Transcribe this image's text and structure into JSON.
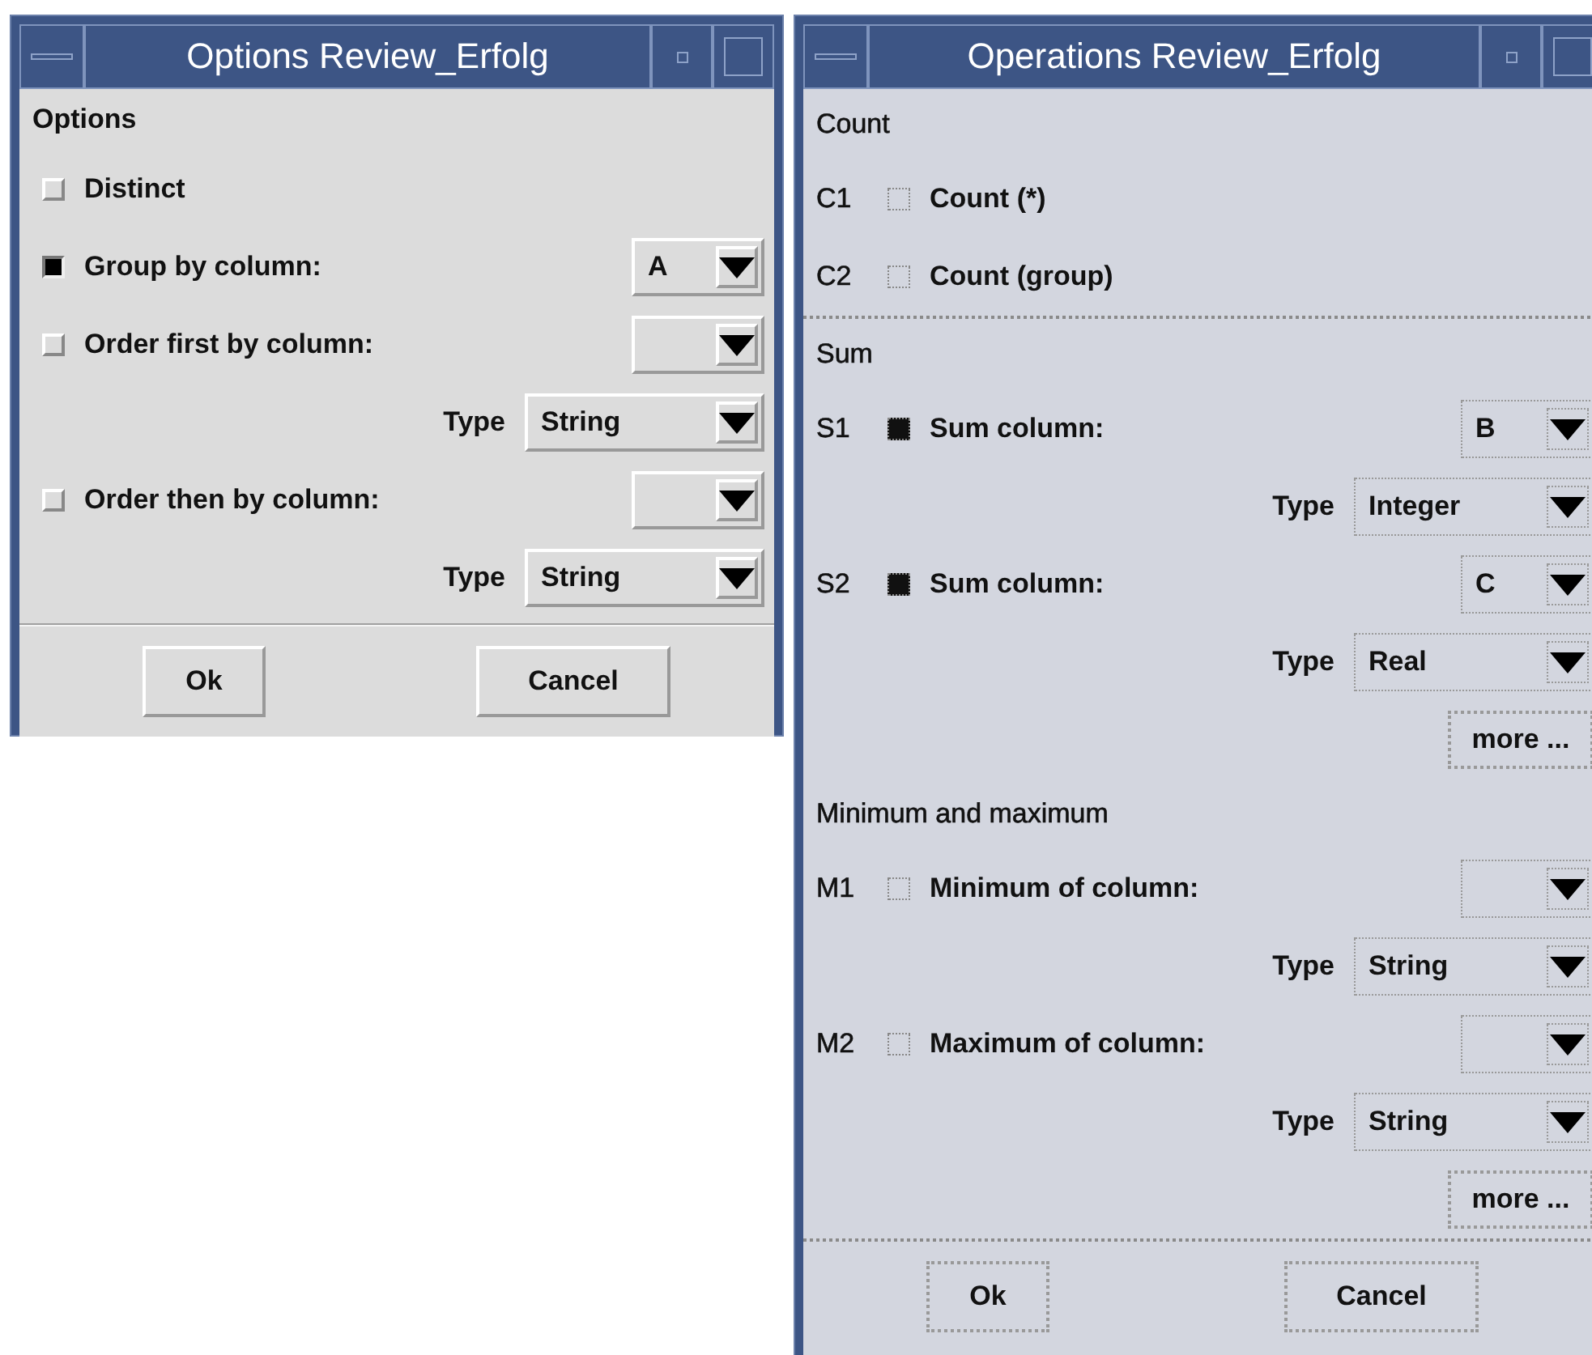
{
  "windows": [
    {
      "title": "Options Review_Erfolg",
      "kind": "motif",
      "panels": [
        {
          "sections": [
            {
              "heading": "Options",
              "rows": [
                {
                  "kind": "check",
                  "label": "Distinct",
                  "checked": false
                },
                {
                  "kind": "check",
                  "label": "Group by column:",
                  "checked": true,
                  "select": {
                    "value": "A"
                  }
                },
                {
                  "kind": "check",
                  "label": "Order first by column:",
                  "checked": false,
                  "select": {}
                },
                {
                  "kind": "type",
                  "label": "Type",
                  "select": {
                    "value": "String"
                  }
                },
                {
                  "kind": "check",
                  "label": "Order then by column:",
                  "checked": false,
                  "select": {}
                },
                {
                  "kind": "type",
                  "label": "Type",
                  "select": {
                    "value": "String"
                  }
                }
              ]
            }
          ]
        }
      ],
      "buttons": [
        "Ok",
        "Cancel"
      ]
    },
    {
      "title": "Operations Review_Erfolg",
      "kind": "dotted",
      "panels": [
        {
          "sections": [
            {
              "heading": "Count",
              "rows": [
                {
                  "kind": "check",
                  "tag": "C1",
                  "label": "Count (*)",
                  "checked": false
                },
                {
                  "kind": "check",
                  "tag": "C2",
                  "label": "Count (group)",
                  "checked": false
                }
              ]
            }
          ]
        },
        {
          "sections": [
            {
              "heading": "Sum",
              "rows": [
                {
                  "kind": "check",
                  "tag": "S1",
                  "label": "Sum column:",
                  "checked": true,
                  "select": {
                    "value": "B"
                  }
                },
                {
                  "kind": "type",
                  "label": "Type",
                  "select": {
                    "value": "Integer"
                  }
                },
                {
                  "kind": "check",
                  "tag": "S2",
                  "label": "Sum column:",
                  "checked": true,
                  "select": {
                    "value": "C"
                  }
                },
                {
                  "kind": "type",
                  "label": "Type",
                  "select": {
                    "value": "Real"
                  }
                },
                {
                  "kind": "more",
                  "label": "more ..."
                }
              ]
            },
            {
              "heading": "Minimum and maximum",
              "rows": [
                {
                  "kind": "check",
                  "tag": "M1",
                  "label": "Minimum of column:",
                  "checked": false,
                  "select": {}
                },
                {
                  "kind": "type",
                  "label": "Type",
                  "select": {
                    "value": "String"
                  }
                },
                {
                  "kind": "check",
                  "tag": "M2",
                  "label": "Maximum of column:",
                  "checked": false,
                  "select": {}
                },
                {
                  "kind": "type",
                  "label": "Type",
                  "select": {
                    "value": "String"
                  }
                },
                {
                  "kind": "more",
                  "label": "more ..."
                }
              ]
            }
          ]
        }
      ],
      "buttons": [
        "Ok",
        "Cancel"
      ]
    }
  ]
}
